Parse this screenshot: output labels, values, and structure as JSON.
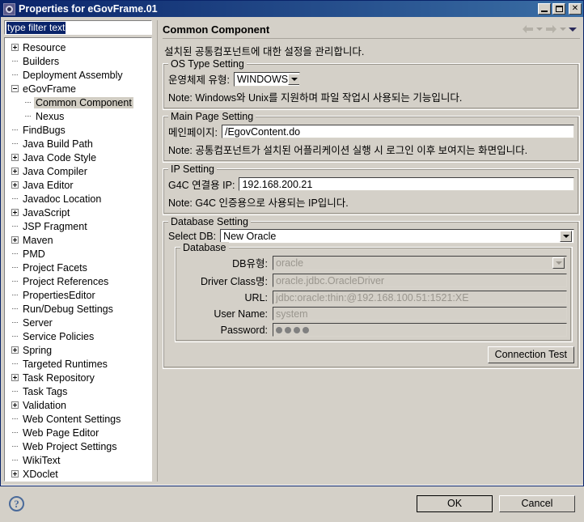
{
  "window": {
    "title": "Properties for eGovFrame.01",
    "icon": "properties-gear-icon",
    "buttons": {
      "minimize": "minimize-icon",
      "maximize": "maximize-icon",
      "close": "close-icon"
    }
  },
  "filter": {
    "value": "type filter text",
    "placeholder": "type filter text"
  },
  "tree": [
    {
      "label": "Resource",
      "level": 0,
      "expander": "plus"
    },
    {
      "label": "Builders",
      "level": 0,
      "expander": "none"
    },
    {
      "label": "Deployment Assembly",
      "level": 0,
      "expander": "none"
    },
    {
      "label": "eGovFrame",
      "level": 0,
      "expander": "minus"
    },
    {
      "label": "Common Component",
      "level": 1,
      "expander": "none",
      "selected": true
    },
    {
      "label": "Nexus",
      "level": 1,
      "expander": "none"
    },
    {
      "label": "FindBugs",
      "level": 0,
      "expander": "none"
    },
    {
      "label": "Java Build Path",
      "level": 0,
      "expander": "none"
    },
    {
      "label": "Java Code Style",
      "level": 0,
      "expander": "plus"
    },
    {
      "label": "Java Compiler",
      "level": 0,
      "expander": "plus"
    },
    {
      "label": "Java Editor",
      "level": 0,
      "expander": "plus"
    },
    {
      "label": "Javadoc Location",
      "level": 0,
      "expander": "none"
    },
    {
      "label": "JavaScript",
      "level": 0,
      "expander": "plus"
    },
    {
      "label": "JSP Fragment",
      "level": 0,
      "expander": "none"
    },
    {
      "label": "Maven",
      "level": 0,
      "expander": "plus"
    },
    {
      "label": "PMD",
      "level": 0,
      "expander": "none"
    },
    {
      "label": "Project Facets",
      "level": 0,
      "expander": "none"
    },
    {
      "label": "Project References",
      "level": 0,
      "expander": "none"
    },
    {
      "label": "PropertiesEditor",
      "level": 0,
      "expander": "none"
    },
    {
      "label": "Run/Debug Settings",
      "level": 0,
      "expander": "none"
    },
    {
      "label": "Server",
      "level": 0,
      "expander": "none"
    },
    {
      "label": "Service Policies",
      "level": 0,
      "expander": "none"
    },
    {
      "label": "Spring",
      "level": 0,
      "expander": "plus"
    },
    {
      "label": "Targeted Runtimes",
      "level": 0,
      "expander": "none"
    },
    {
      "label": "Task Repository",
      "level": 0,
      "expander": "plus"
    },
    {
      "label": "Task Tags",
      "level": 0,
      "expander": "none"
    },
    {
      "label": "Validation",
      "level": 0,
      "expander": "plus"
    },
    {
      "label": "Web Content Settings",
      "level": 0,
      "expander": "none"
    },
    {
      "label": "Web Page Editor",
      "level": 0,
      "expander": "none"
    },
    {
      "label": "Web Project Settings",
      "level": 0,
      "expander": "none"
    },
    {
      "label": "WikiText",
      "level": 0,
      "expander": "none"
    },
    {
      "label": "XDoclet",
      "level": 0,
      "expander": "plus"
    }
  ],
  "page": {
    "title": "Common Component",
    "description": "설치된 공통컴포넌트에 대한 설정을 관리합니다.",
    "nav": {
      "back": "back-arrow-icon",
      "back_menu": "back-dropdown-icon",
      "forward": "forward-arrow-icon",
      "forward_menu": "forward-dropdown-icon",
      "view_menu": "view-menu-icon"
    }
  },
  "os_type_setting": {
    "legend": "OS Type Setting",
    "label": "운영체제 유형:",
    "value": "WINDOWS",
    "note": "Note: Windows와 Unix를 지원하며 파일 작업시 사용되는 기능입니다."
  },
  "main_page_setting": {
    "legend": "Main Page Setting",
    "label": "메인페이지:",
    "value": "/EgovContent.do",
    "note": "Note: 공통컴포넌트가 설치된 어플리케이션 실행 시 로그인 이후  보여지는 화면입니다."
  },
  "ip_setting": {
    "legend": "IP Setting",
    "label": "G4C 연결용 IP:",
    "value": "192.168.200.21",
    "note": "Note: G4C 인증용으로 사용되는 IP입니다."
  },
  "database_setting": {
    "legend": "Database Setting",
    "select_db_label": "Select DB:",
    "select_db_value": "New Oracle",
    "inner_legend": "Database",
    "fields": {
      "db_type_label": "DB유형:",
      "db_type_value": "oracle",
      "driver_class_label": "Driver Class명:",
      "driver_class_value": "oracle.jdbc.OracleDriver",
      "url_label": "URL:",
      "url_value": "jdbc:oracle:thin:@192.168.100.51:1521:XE",
      "user_name_label": "User Name:",
      "user_name_value": "system",
      "password_label": "Password:",
      "password_masked": "••••",
      "password_dot_count": 4
    },
    "connection_test_label": "Connection Test"
  },
  "footer": {
    "help": "?",
    "ok_label": "OK",
    "cancel_label": "Cancel"
  },
  "colors": {
    "dialog_bg": "#d4d0c8",
    "titlebar_start": "#0a246a",
    "titlebar_end": "#3a6ea5",
    "selection": "#0a246a",
    "tree_selected": "#d2cec4",
    "disabled_text": "#9a968e"
  }
}
